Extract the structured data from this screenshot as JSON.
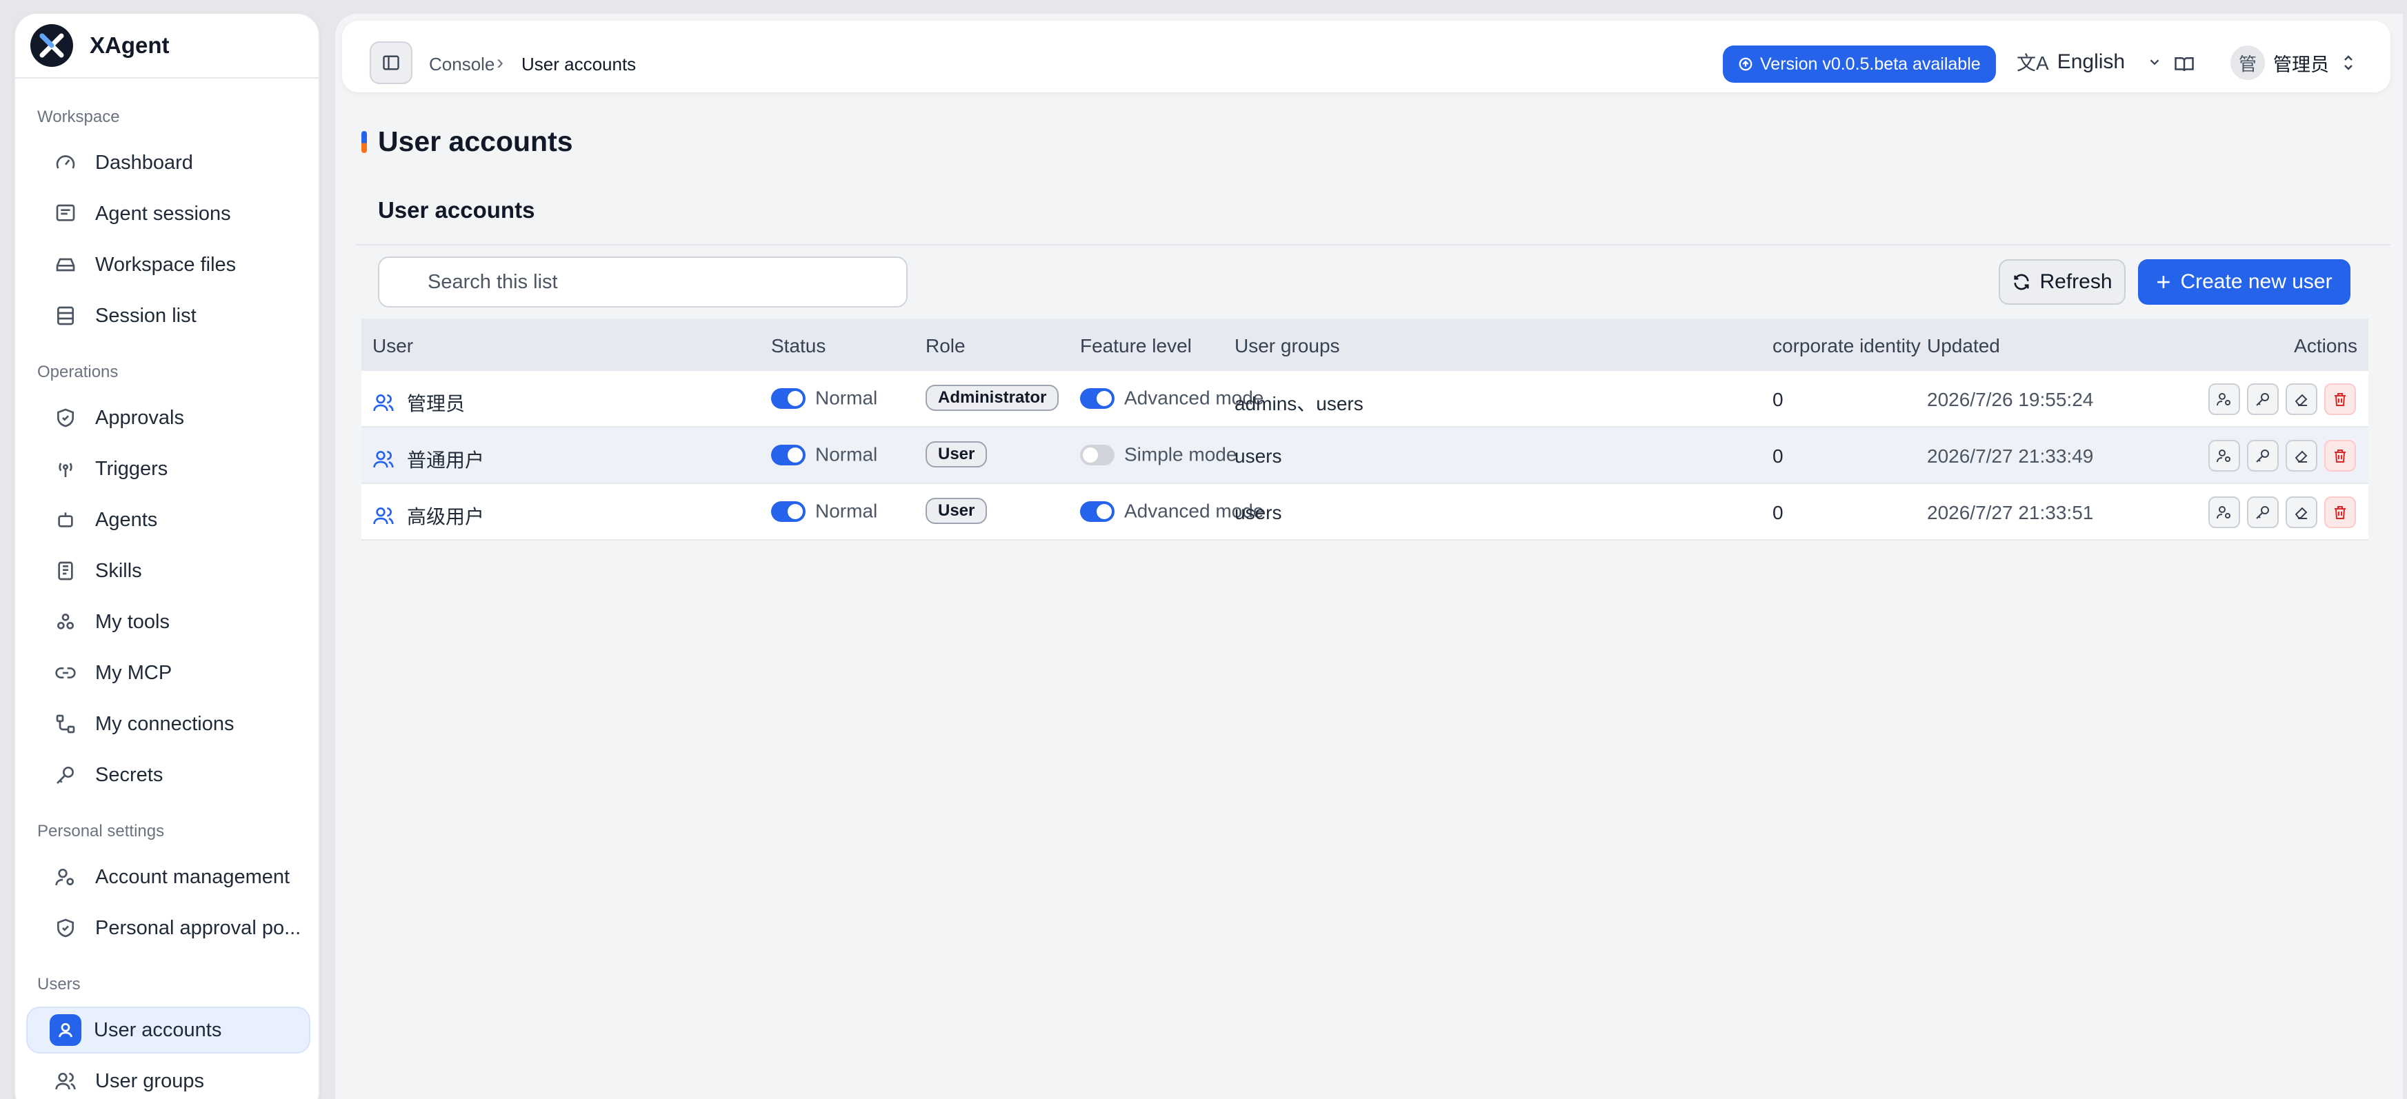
{
  "brand": {
    "name": "XAgent"
  },
  "sidebar": {
    "sections": [
      {
        "label": "Workspace",
        "items": [
          {
            "label": "Dashboard",
            "icon": "gauge-icon"
          },
          {
            "label": "Agent sessions",
            "icon": "chat-list-icon"
          },
          {
            "label": "Workspace files",
            "icon": "drive-icon"
          },
          {
            "label": "Session list",
            "icon": "table-icon"
          }
        ]
      },
      {
        "label": "Operations",
        "items": [
          {
            "label": "Approvals",
            "icon": "shield-check-icon"
          },
          {
            "label": "Triggers",
            "icon": "radio-tower-icon"
          },
          {
            "label": "Agents",
            "icon": "robot-icon"
          },
          {
            "label": "Skills",
            "icon": "notebook-icon"
          },
          {
            "label": "My tools",
            "icon": "blocks-icon"
          },
          {
            "label": "My MCP",
            "icon": "link-icon"
          },
          {
            "label": "My connections",
            "icon": "connections-icon"
          },
          {
            "label": "Secrets",
            "icon": "key-icon"
          }
        ]
      },
      {
        "label": "Personal settings",
        "items": [
          {
            "label": "Account management",
            "icon": "user-cog-icon"
          },
          {
            "label": "Personal approval po...",
            "icon": "shield-check-icon"
          }
        ]
      },
      {
        "label": "Users",
        "items": [
          {
            "label": "User accounts",
            "icon": "user-circle-icon",
            "active": true
          },
          {
            "label": "User groups",
            "icon": "users-icon"
          }
        ]
      }
    ]
  },
  "topbar": {
    "breadcrumb": [
      "Console",
      "User accounts"
    ],
    "version_badge": "Version v0.0.5.beta available",
    "language": "English",
    "avatar_char": "管",
    "user_name": "管理员"
  },
  "page": {
    "title": "User accounts",
    "subtitle": "User accounts",
    "search_placeholder": "Search this list",
    "refresh_label": "Refresh",
    "create_label": "Create new user"
  },
  "table": {
    "headers": {
      "user": "User",
      "status": "Status",
      "role": "Role",
      "feature": "Feature level",
      "groups": "User groups",
      "corp": "corporate identity",
      "updated": "Updated",
      "actions": "Actions"
    },
    "rows": [
      {
        "user": "管理员",
        "status": "Normal",
        "role": "Administrator",
        "feature": "Advanced mode",
        "feature_on": true,
        "groups": "admins、users",
        "corp": "0",
        "updated": "2026/7/26 19:55:24"
      },
      {
        "user": "普通用户",
        "status": "Normal",
        "role": "User",
        "feature": "Simple mode",
        "feature_on": false,
        "groups": "users",
        "corp": "0",
        "updated": "2026/7/27 21:33:49"
      },
      {
        "user": "高级用户",
        "status": "Normal",
        "role": "User",
        "feature": "Advanced mode",
        "feature_on": true,
        "groups": "users",
        "corp": "0",
        "updated": "2026/7/27 21:33:51"
      }
    ]
  },
  "colors": {
    "accent": "#2563eb",
    "danger": "#dc2626"
  }
}
